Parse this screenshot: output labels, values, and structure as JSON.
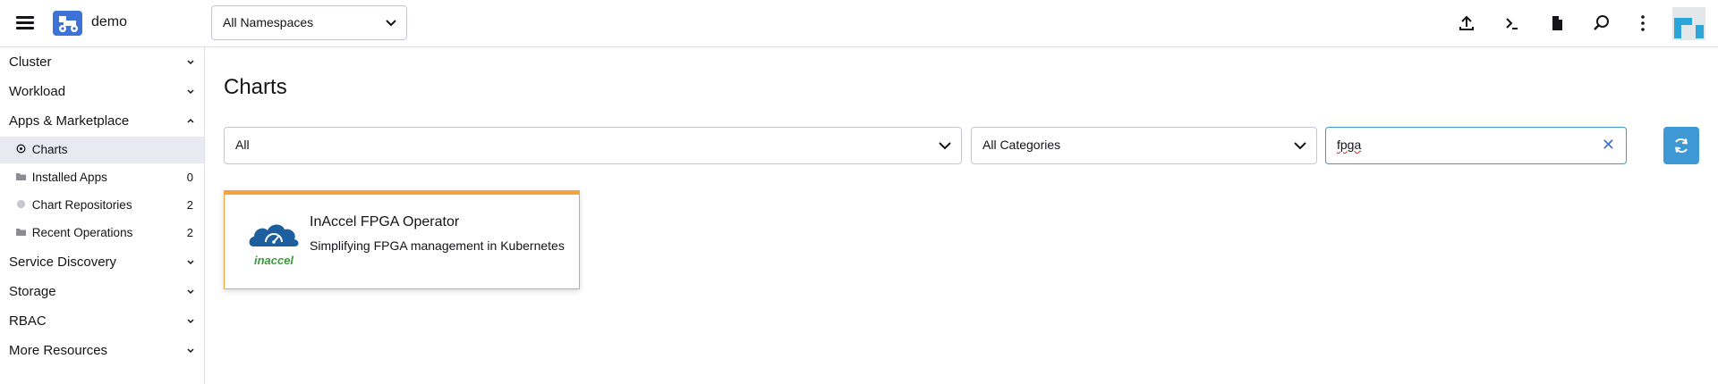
{
  "header": {
    "cluster_name": "demo",
    "namespace_select": "All Namespaces",
    "icons": [
      "upload-icon",
      "terminal-icon",
      "file-icon",
      "search-icon",
      "more-icon"
    ]
  },
  "sidebar": {
    "groups": [
      {
        "label": "Cluster"
      },
      {
        "label": "Workload"
      },
      {
        "label": "Apps & Marketplace"
      },
      {
        "label": "Service Discovery"
      },
      {
        "label": "Storage"
      },
      {
        "label": "RBAC"
      },
      {
        "label": "More Resources"
      }
    ],
    "apps_items": [
      {
        "label": "Charts",
        "count": ""
      },
      {
        "label": "Installed Apps",
        "count": "0"
      },
      {
        "label": "Chart Repositories",
        "count": "2"
      },
      {
        "label": "Recent Operations",
        "count": "2"
      }
    ]
  },
  "main": {
    "title": "Charts",
    "filter_repo": "All",
    "filter_category": "All Categories",
    "search_value": "fpga",
    "card": {
      "title": "InAccel FPGA Operator",
      "description": "Simplifying FPGA management in Kubernetes",
      "logo_text": "inaccel"
    }
  },
  "colors": {
    "accent": "#3d98d3",
    "card_border": "#f2a33a",
    "active_bg": "#e9eaf1"
  }
}
